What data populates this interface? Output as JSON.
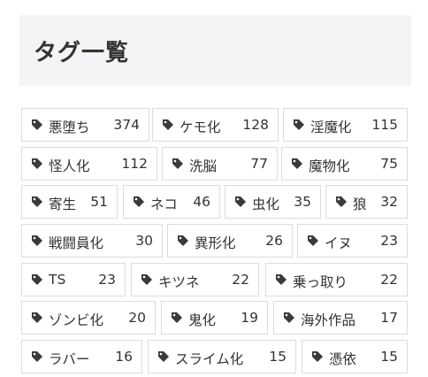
{
  "header": {
    "title": "タグ一覧"
  },
  "tag_icon": "tag-icon",
  "tags": [
    {
      "name": "悪堕ち",
      "count": "374"
    },
    {
      "name": "ケモ化",
      "count": "128"
    },
    {
      "name": "淫魔化",
      "count": "115"
    },
    {
      "name": "怪人化",
      "count": "112"
    },
    {
      "name": "洗脳",
      "count": "77"
    },
    {
      "name": "魔物化",
      "count": "75"
    },
    {
      "name": "寄生",
      "count": "51"
    },
    {
      "name": "ネコ",
      "count": "46"
    },
    {
      "name": "虫化",
      "count": "35"
    },
    {
      "name": "狼",
      "count": "32"
    },
    {
      "name": "戦闘員化",
      "count": "30"
    },
    {
      "name": "異形化",
      "count": "26"
    },
    {
      "name": "イヌ",
      "count": "23"
    },
    {
      "name": "TS",
      "count": "23"
    },
    {
      "name": "キツネ",
      "count": "22"
    },
    {
      "name": "乗っ取り",
      "count": "22"
    },
    {
      "name": "ゾンビ化",
      "count": "20"
    },
    {
      "name": "鬼化",
      "count": "19"
    },
    {
      "name": "海外作品",
      "count": "17"
    },
    {
      "name": "ラバー",
      "count": "16"
    },
    {
      "name": "スライム化",
      "count": "15"
    },
    {
      "name": "憑依",
      "count": "15"
    }
  ]
}
